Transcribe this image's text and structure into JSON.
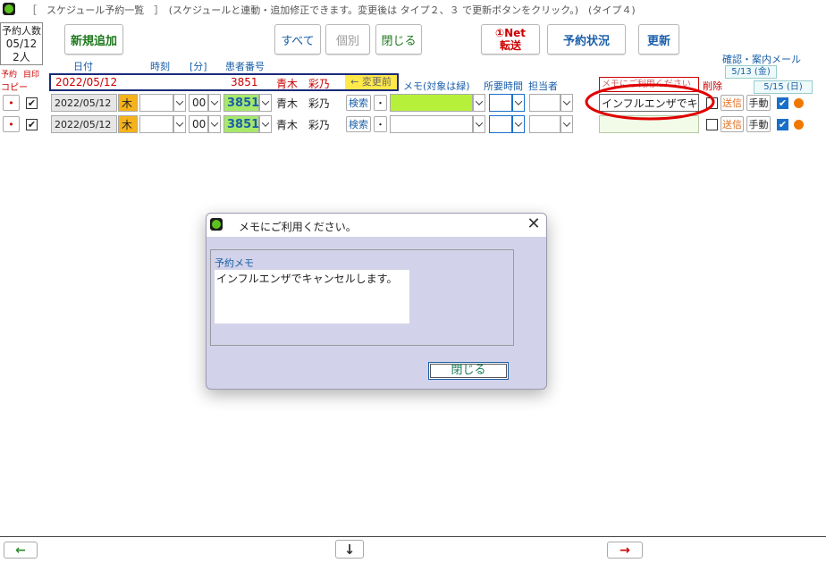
{
  "header": {
    "title_line": "［　スケジュール予約一覧　］　(スケジュールと連動・追加修正できます。変更後は タイプ２、３ で更新ボタンをクリック。)　(タイプ４)"
  },
  "summary": {
    "label": "予約人数",
    "date": "05/12",
    "count": "2人"
  },
  "left_labels": {
    "yoyaku": "予約",
    "mokuin": "目印",
    "copy": "コピー"
  },
  "toolbar": {
    "new_label": "新規追加",
    "all_label": "すべて",
    "individual_label": "個別",
    "close_label": "閉じる",
    "net_line1": "①Net",
    "net_line2": "転送",
    "status_label": "予約状況",
    "update_label": "更新"
  },
  "mail": {
    "title": "確認・案内メール",
    "date1": "5/13 (金)",
    "date2": "5/15 (日)"
  },
  "columns": {
    "date": "日付",
    "time": "時刻",
    "min": "[分]",
    "patient_no": "患者番号",
    "memo": "メモ(対象は緑)",
    "duration": "所要時間",
    "staff": "担当者",
    "delete": "削除"
  },
  "selected": {
    "date": "2022/05/12",
    "patient_no": "3851",
    "name": "青木　彩乃",
    "change_label": "← 変更前",
    "memo_placeholder": "メモにご利用ください"
  },
  "rows": [
    {
      "mark": "•",
      "checked": "✔",
      "date": "2022/05/12",
      "weekday": "木",
      "minute": "00",
      "patient_no": "3851",
      "name": "青木　彩乃",
      "search": "検索",
      "dot": "・",
      "memo": "インフルエンザでキャ",
      "send": "送信",
      "manual": "手動"
    },
    {
      "mark": "•",
      "checked": "✔",
      "date": "2022/05/12",
      "weekday": "木",
      "minute": "00",
      "patient_no": "3851",
      "name": "青木　彩乃",
      "search": "検索",
      "dot": "・",
      "memo": "",
      "send": "送信",
      "manual": "手動"
    }
  ],
  "dialog": {
    "title": "メモにご利用ください。",
    "group_label": "予約メモ",
    "memo_text": "インフルエンザでキャンセルします。",
    "close_label": "閉じる"
  },
  "footer": {
    "prev": "←",
    "down": "↓",
    "next": "→"
  },
  "colors": {
    "accent_green": "#b7f03a",
    "weekday_orange": "#f5b21a",
    "dialog_bg": "#d2d3ea",
    "highlight_red": "#e00000"
  }
}
